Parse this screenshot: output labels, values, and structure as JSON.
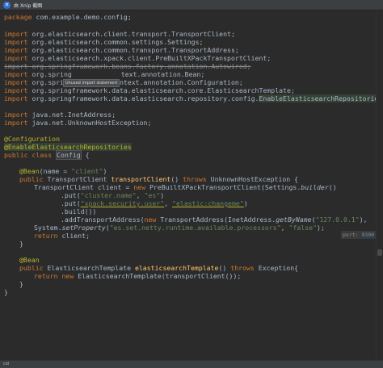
{
  "window": {
    "title": "由 Xnip 截图"
  },
  "status": {
    "text": "coi"
  },
  "editor": {
    "l_pkg_kw": "package",
    "l_pkg_rest": " com.example.demo.config;",
    "imp": "import",
    "l3": " org.elasticsearch.client.transport.TransportClient;",
    "l4": " org.elasticsearch.common.settings.Settings;",
    "l5": " org.elasticsearch.common.transport.TransportAddress;",
    "l6": " org.elasticsearch.xpack.client.PreBuiltXPackTransportClient;",
    "l7": "import org.springframework.beans.factory.annotation.Autowired;",
    "l8_a": " org.spring",
    "l8_b": "text.annotation.Bean;",
    "l9": " org.springframework.context.annotation.Configuration;",
    "l10": " org.springframework.data.elasticsearch.core.ElasticsearchTemplate;",
    "l11_a": " org.springframework.data.elasticsearch.repository.config.",
    "l11_b": "EnableElasticsearchRepositories",
    "l11_c": ";",
    "l13": " java.net.InetAddress;",
    "l14": " java.net.UnknownHostException;",
    "l16": "@Configuration",
    "l17": "@EnableElasticsearchRepositories",
    "l18_kw": "public class",
    "l18_cls": "Config",
    "l18_rest": " {",
    "l20_ann": "@Bean",
    "l20_a": "(name = ",
    "l20_str": "\"client\"",
    "l20_b": ")",
    "l21_kw": "public",
    "l21_a": " TransportClient ",
    "l21_fn": "transportClient",
    "l21_b": "() ",
    "l21_kw2": "throws",
    "l21_c": " UnknownHostException {",
    "l22_a": "TransportClient client = ",
    "l22_kw": "new",
    "l22_b": " PreBuiltXPackTransportClient(Settings.",
    "l22_it": "builder",
    "l22_c": "()",
    "l23_a": ".put(",
    "l23_s1": "\"cluster.name\"",
    "l23_b": ", ",
    "l23_s2": "\"es\"",
    "l23_c": ")",
    "l24_a": ".put(",
    "l24_s1": "\"xpack.security.user\"",
    "l24_b": ", ",
    "l24_s2": "\"elastic:changeme\"",
    "l24_c": ")",
    "l25": ".build())",
    "l26_a": ".addTransportAddress(",
    "l26_kw": "new",
    "l26_b": " TransportAddress(InetAddress.",
    "l26_it": "getByName",
    "l26_c": "(",
    "l26_str": "\"127.0.0.1\"",
    "l26_d": "), ",
    "l27_a": "System.",
    "l27_it": "setProperty",
    "l27_b": "(",
    "l27_s1": "\"es.set.netty.runtime.available.processors\"",
    "l27_c": ", ",
    "l27_s2": "\"false\"",
    "l27_d": ");",
    "l28_kw": "return",
    "l28_rest": " client;",
    "l29": "}",
    "l31": "@Bean",
    "l32_kw": "public",
    "l32_a": " ElasticsearchTemplate ",
    "l32_fn": "elasticsearchTemplate",
    "l32_b": "() ",
    "l32_kw2": "throws",
    "l32_c": " Exception{",
    "l33_kw": "return new",
    "l33_rest": " ElasticsearchTemplate(transportClient());",
    "l34": "}",
    "l35": "}"
  },
  "tooltip": {
    "text": "Unused import statement"
  },
  "hint": {
    "label": "port:",
    "value": "9300"
  }
}
